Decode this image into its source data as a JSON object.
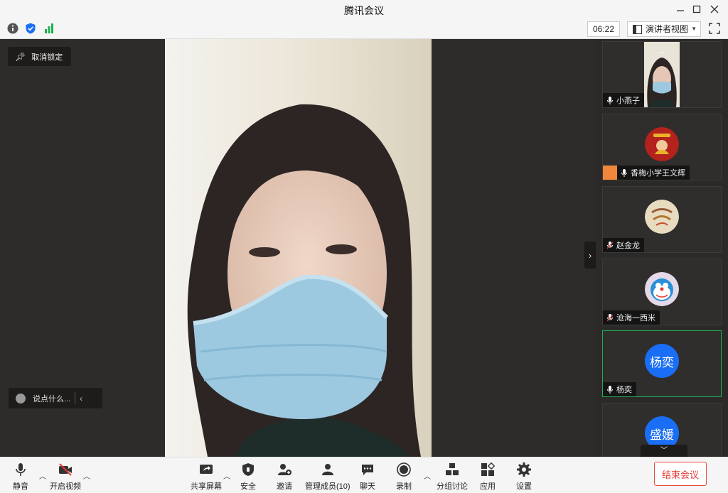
{
  "window": {
    "title": "腾讯会议"
  },
  "toolbar": {
    "timer": "06:22",
    "view_label": "演讲者视图"
  },
  "stage": {
    "unlock_label": "取消锁定",
    "chat_placeholder": "说点什么..."
  },
  "participants": [
    {
      "name": "小燕子",
      "avatar": "video"
    },
    {
      "name": "香梅小学王文辉",
      "avatar": "image"
    },
    {
      "name": "赵金龙",
      "avatar": "image"
    },
    {
      "name": "沧海一西米",
      "avatar": "image"
    },
    {
      "name": "杨奕",
      "avatar_text": "杨奕",
      "active": true
    },
    {
      "name": "盛媛",
      "avatar_text": "盛媛"
    }
  ],
  "bottom": {
    "mute": "静音",
    "video": "开启视频",
    "share": "共享屏幕",
    "security": "安全",
    "invite": "邀请",
    "members": "管理成员(10)",
    "chat": "聊天",
    "record": "录制",
    "breakout": "分组讨论",
    "apps": "应用",
    "settings": "设置",
    "end": "结束会议"
  },
  "colors": {
    "accent_blue": "#1a6ef5",
    "active_border": "#1fae51",
    "end_red": "#e53935",
    "signal_green": "#1fae51"
  }
}
